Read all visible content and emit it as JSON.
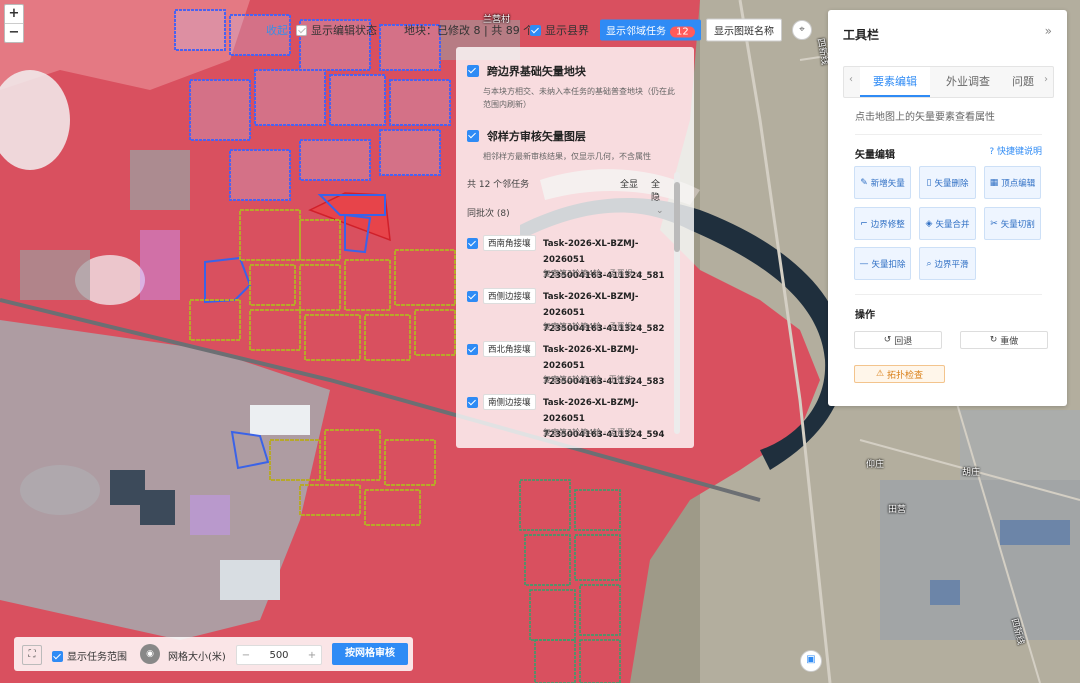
{
  "map": {
    "zoom_in": "+",
    "zoom_out": "−",
    "place_labels": {
      "village_top": "兰营村",
      "road_right": "四新线",
      "road_bottom_right": "四新线",
      "place_qiang": "仰庄",
      "place_hu": "胡庄",
      "place_tian": "田营"
    }
  },
  "topbar": {
    "collapse_link": "收起",
    "show_edit_state": "显示编辑状态",
    "show_edit_state_checked": false,
    "parcel_stats": "地块：已修改 8 | 共 89 个",
    "show_county": "显示县界",
    "show_county_checked": true,
    "neighbor_tasks_button": "显示邻域任务",
    "neighbor_tasks_count": "12",
    "show_map_name_button": "显示图斑名称",
    "locate_icon": "map-pin-icon"
  },
  "layers": {
    "cross_border": {
      "title": "跨边界基础矢量地块",
      "checked": true,
      "desc_line1": "与本块方相交、未纳入本任务的基础普查地块（仍在此",
      "desc_line2": "范围内刷新）"
    },
    "neighbor": {
      "title": "邻样方审核矢量图层",
      "checked": true,
      "desc": "相邻样方最新审核结果，仅显示几何，不含属性"
    },
    "tasks_summary": "共 12 个邻任务",
    "show_all": "全显",
    "hide_all": "全隐",
    "group_label": "同批次 (8)",
    "tasks": [
      {
        "tag": "西南角接壤",
        "code_line1": "Task-2026-XL-BZMJ-2026051",
        "code_line2": "7235004163-411324_581",
        "meta": "复审第3轮第4轮 · 孟晋根 ···",
        "checked": true
      },
      {
        "tag": "西侧边接壤",
        "code_line1": "Task-2026-XL-BZMJ-2026051",
        "code_line2": "7235004163-411324_582",
        "meta": "复审第3轮第4轮 · 孟晋根 ···",
        "checked": true
      },
      {
        "tag": "西北角接壤",
        "code_line1": "Task-2026-XL-BZMJ-2026051",
        "code_line2": "7235004163-411324_583",
        "meta": "复审第6轮第7轮 · 王德伟",
        "checked": true
      },
      {
        "tag": "南侧边接壤",
        "code_line1": "Task-2026-XL-BZMJ-2026051",
        "code_line2": "7235004163-411324_594",
        "meta": "复审第3轮第4轮 · 孟晋根 ···",
        "checked": true
      }
    ]
  },
  "toolbar": {
    "title": "工具栏",
    "collapse_icon": "double-chevron-right-icon",
    "tabs": [
      "要素编辑",
      "外业调查",
      "问题"
    ],
    "active_tab": "要素编辑",
    "hint": "点击地图上的矢量要素查看属性",
    "vector_edit_label": "矢量编辑",
    "shortcut_label": "快捷键说明",
    "tools": [
      {
        "label": "新增矢量",
        "icon": "✎"
      },
      {
        "label": "矢量删除",
        "icon": "🗑"
      },
      {
        "label": "顶点编辑",
        "icon": "▦"
      },
      {
        "label": "边界修整",
        "icon": "⌐"
      },
      {
        "label": "矢量合并",
        "icon": "◈"
      },
      {
        "label": "矢量切割",
        "icon": "✂"
      },
      {
        "label": "矢量扣除",
        "icon": "—"
      },
      {
        "label": "边界平滑",
        "icon": "⌕"
      }
    ],
    "operations_label": "操作",
    "undo": "回退",
    "redo": "重做",
    "topology_check": "拓扑检查"
  },
  "bottombar": {
    "fullscreen_icon": "fullscreen-icon",
    "show_task_range": "显示任务范围",
    "show_task_range_checked": true,
    "grid_size_label": "网格大小(米)",
    "grid_size_value": "500",
    "minus": "−",
    "plus": "+",
    "grid_review_button": "按网格审核"
  },
  "colors": {
    "accent": "#2f8bf5",
    "badge": "#ff5b5b",
    "vegetation": "#d9505f",
    "parcel_blue": "#4a63f0",
    "parcel_yellow": "#b7a82a",
    "parcel_green": "#2fa36b",
    "river": "#1f2f3d"
  }
}
